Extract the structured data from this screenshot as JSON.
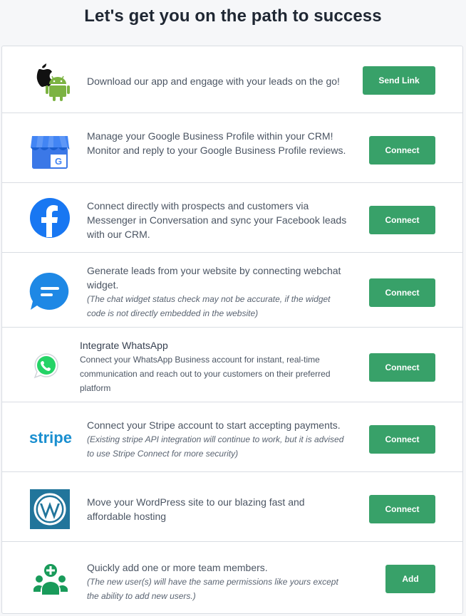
{
  "title": "Let's get you on the path to success",
  "rows": [
    {
      "icon": "apple-android-icon",
      "text": "Download our app and engage with your leads on the go!",
      "note": "",
      "button": "Send Link"
    },
    {
      "icon": "google-business-icon",
      "text": "Manage your Google Business Profile within your CRM! Monitor and reply to your Google Business Profile reviews.",
      "note": "",
      "button": "Connect"
    },
    {
      "icon": "facebook-icon",
      "text": "Connect directly with prospects and customers via Messenger in Conversation and sync your Facebook leads with our CRM.",
      "note": "",
      "button": "Connect"
    },
    {
      "icon": "webchat-icon",
      "text": "Generate leads from your website by connecting webchat widget.",
      "note": "(The chat widget status check may not be accurate, if the widget code is not directly embedded in the website)",
      "button": "Connect"
    },
    {
      "icon": "whatsapp-icon",
      "title": "Integrate WhatsApp",
      "text": "Connect your WhatsApp Business account for instant, real-time communication and reach out to your customers on their preferred platform",
      "button": "Connect"
    },
    {
      "icon": "stripe-icon",
      "icon_text": "stripe",
      "text": "Connect your Stripe account to start accepting payments.",
      "note": "(Existing stripe API integration will continue to work, but it is advised to use Stripe Connect for more security)",
      "button": "Connect"
    },
    {
      "icon": "wordpress-icon",
      "text": "Move your WordPress site to our blazing fast and affordable hosting",
      "note": "",
      "button": "Connect"
    },
    {
      "icon": "team-add-icon",
      "text": "Quickly add one or more team members.",
      "note": "(The new user(s) will have the same permissions like yours except the ability to add new users.)",
      "button": "Add"
    }
  ],
  "colors": {
    "button": "#38a169",
    "facebook": "#1877f2",
    "webchat": "#1e88e5",
    "whatsapp": "#25d366",
    "stripe": "#1a8fd0",
    "wordpress": "#21759b",
    "team": "#199b5a"
  }
}
